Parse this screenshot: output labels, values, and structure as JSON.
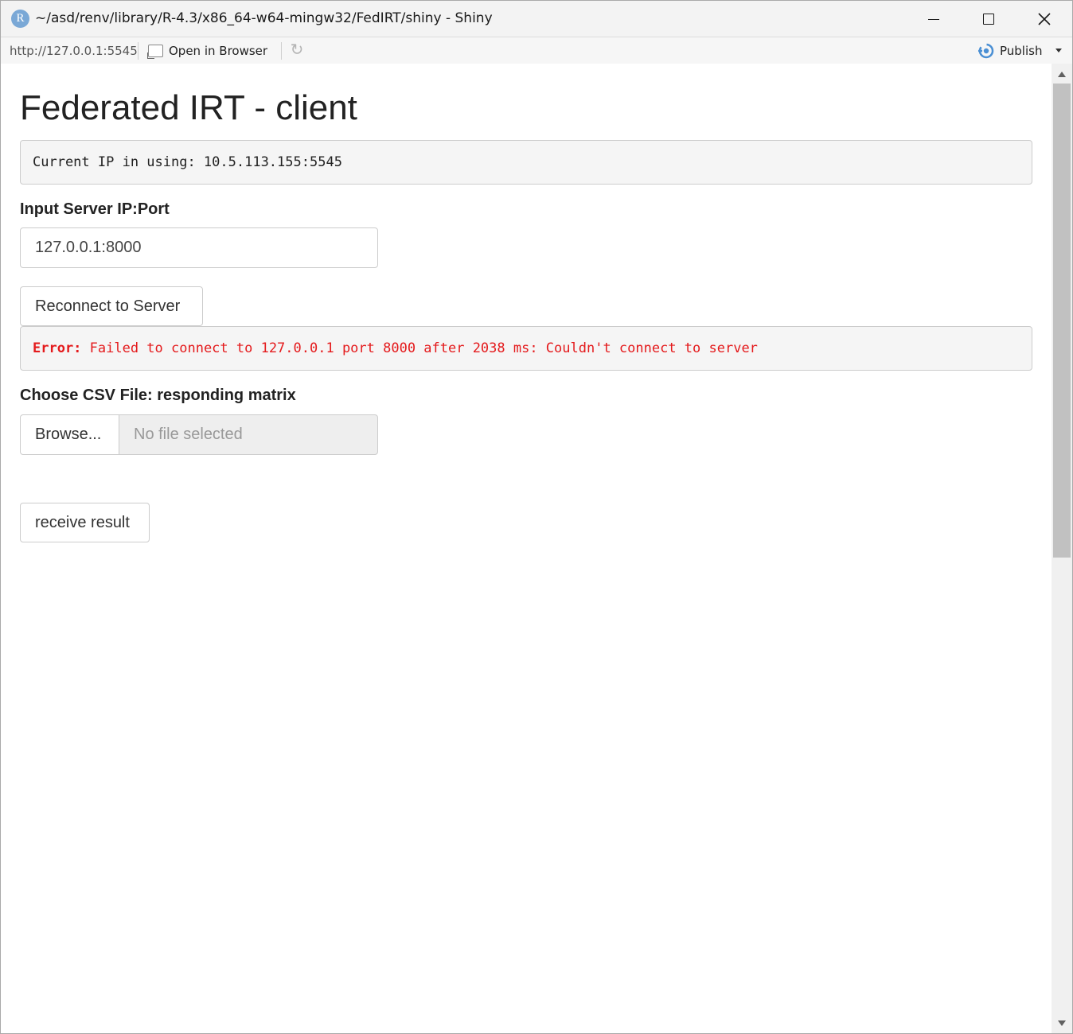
{
  "window": {
    "title": "~/asd/renv/library/R-4.3/x86_64-w64-mingw32/FedIRT/shiny - Shiny",
    "logo_letter": "R"
  },
  "toolbar": {
    "url": "http://127.0.0.1:5545",
    "open_in_browser": "Open in Browser",
    "publish": "Publish"
  },
  "page": {
    "title": "Federated IRT - client",
    "current_ip": "Current IP in using: 10.5.113.155:5545",
    "server_label": "Input Server IP:Port",
    "server_value": "127.0.0.1:8000",
    "reconnect_button": "Reconnect to Server",
    "error_prefix": "Error:",
    "error_message": " Failed to connect to 127.0.0.1 port 8000 after 2038 ms: Couldn't connect to server",
    "csv_label": "Choose CSV File: responding matrix",
    "browse_button": "Browse...",
    "file_placeholder": "No file selected",
    "receive_button": "receive result"
  },
  "colors": {
    "error": "#e41a1c",
    "publish_icon": "#4a8fd4"
  }
}
